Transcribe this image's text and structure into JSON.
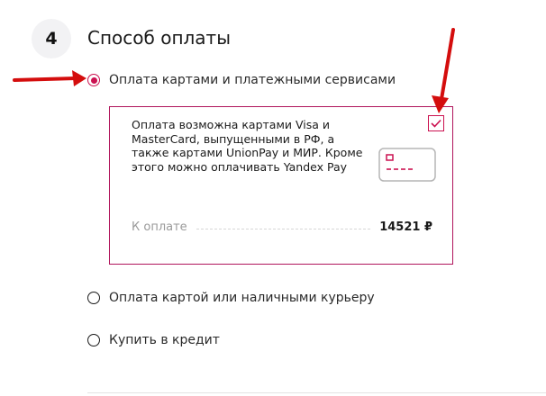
{
  "step": {
    "number": "4",
    "title": "Способ оплаты"
  },
  "payment_options": [
    {
      "label": "Оплата картами и платежными сервисами",
      "selected": true
    },
    {
      "label": "Оплата картой или наличными курьеру",
      "selected": false
    },
    {
      "label": "Купить в кредит",
      "selected": false
    }
  ],
  "card_box": {
    "description": "Оплата возможна картами Visa и MasterCard, выпущенными в РФ, а также картами UnionPay и МИР. Кроме этого можно оплачивать Yandex Pay",
    "checked": true,
    "amount_label": "К оплате",
    "amount_value": "14521 ₽",
    "icon": "credit-card-icon"
  },
  "colors": {
    "accent": "#cb1150",
    "annotation_arrow": "#d40d0d"
  }
}
